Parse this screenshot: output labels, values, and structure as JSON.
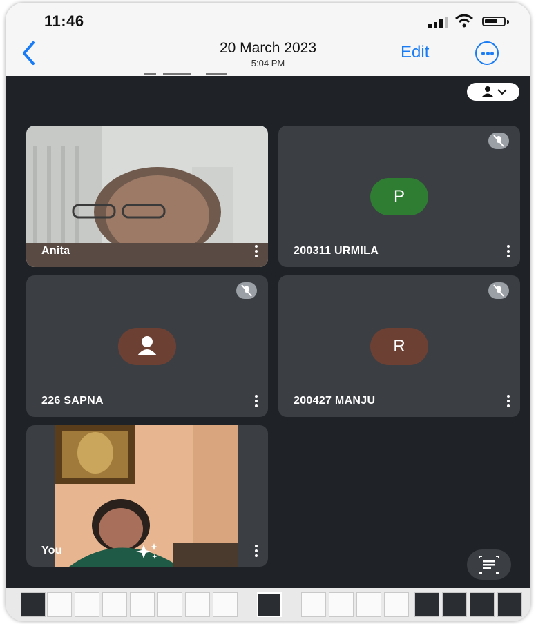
{
  "status_bar": {
    "time": "11:46"
  },
  "nav": {
    "title": "20 March 2023",
    "subtitle": "5:04 PM",
    "edit_label": "Edit"
  },
  "participants": [
    {
      "name": "Anita",
      "type": "video"
    },
    {
      "name": "200311 URMILA",
      "type": "avatar",
      "initial": "P",
      "avatar_color": "#2e7d32",
      "muted": true
    },
    {
      "name": "226 SAPNA",
      "type": "avatar",
      "icon": "person-icon",
      "avatar_color": "#6d4034",
      "muted": true
    },
    {
      "name": "200427 MANJU",
      "type": "avatar",
      "initial": "R",
      "avatar_color": "#6d4034",
      "muted": true
    },
    {
      "name": "You",
      "type": "video"
    }
  ],
  "colors": {
    "accent": "#1a7cf4",
    "meet_background": "#1f2226",
    "tile": "#3b3e43"
  },
  "icons": [
    "back-chevron-icon",
    "more-options-icon",
    "view-layout-icon",
    "mic-off-icon",
    "tile-menu-icon",
    "sparkle-effects-icon",
    "captions-icon"
  ]
}
